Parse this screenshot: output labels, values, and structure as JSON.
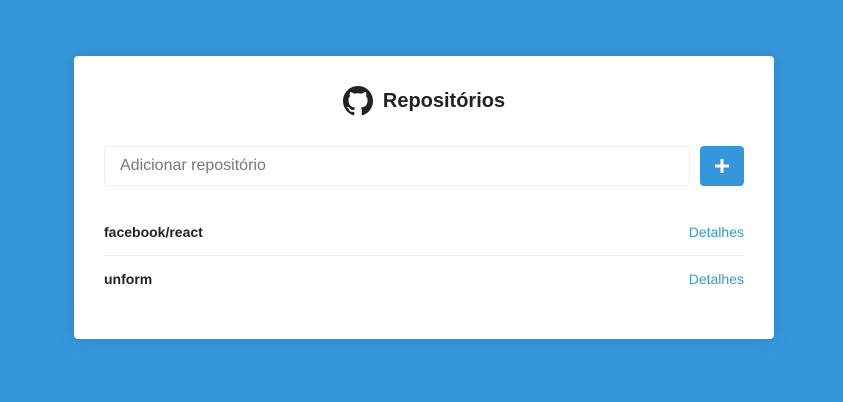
{
  "header": {
    "icon": "github-icon",
    "title": "Repositórios"
  },
  "form": {
    "input_value": "",
    "input_placeholder": "Adicionar repositório",
    "submit_icon": "plus-icon"
  },
  "repositories": [
    {
      "name": "facebook/react",
      "link_label": "Detalhes"
    },
    {
      "name": "unform",
      "link_label": "Detalhes"
    }
  ],
  "colors": {
    "background": "#3597db",
    "accent": "#3597db",
    "card": "#ffffff",
    "text": "#222222"
  }
}
